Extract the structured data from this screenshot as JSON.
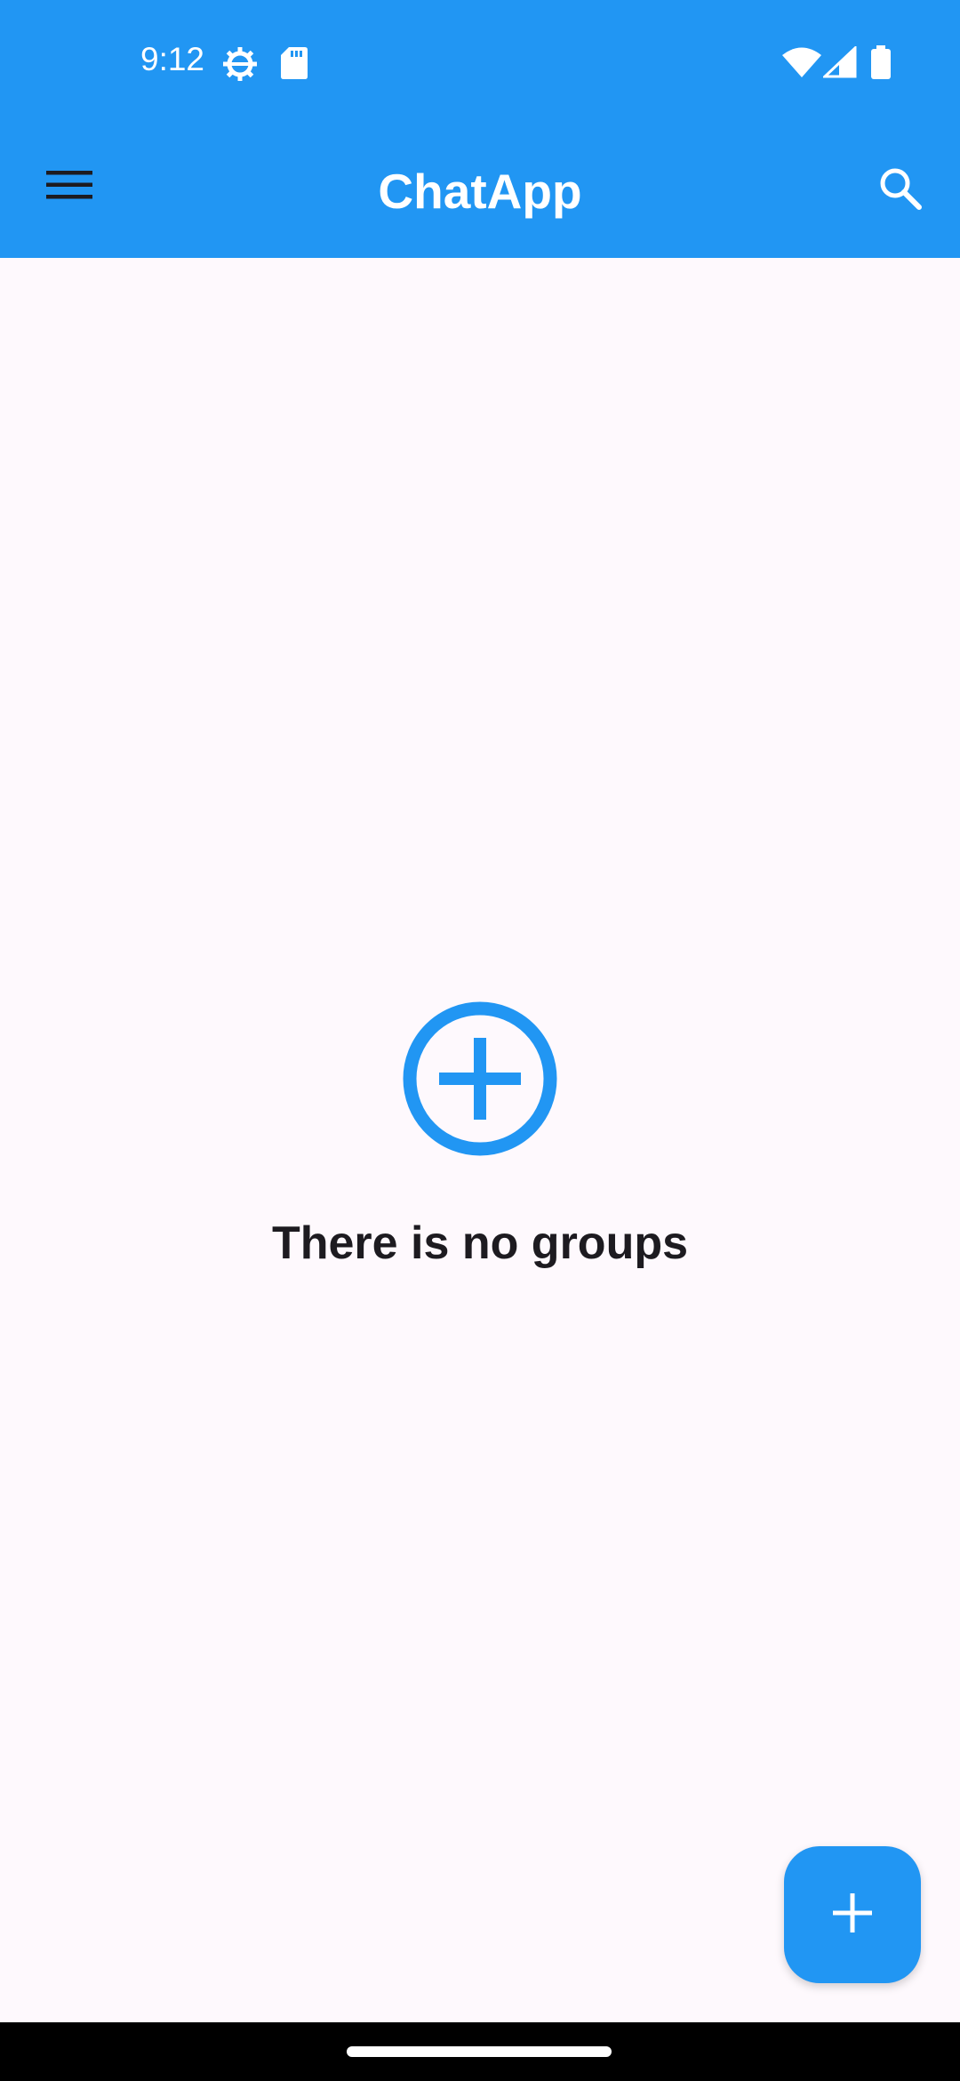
{
  "status_bar": {
    "time": "9:12",
    "icons": [
      "gear-icon",
      "sd-card-icon",
      "wifi-icon",
      "signal-icon",
      "battery-icon"
    ]
  },
  "app_bar": {
    "title": "ChatApp",
    "menu_icon": "menu-icon",
    "search_icon": "search-icon"
  },
  "empty_state": {
    "icon": "add-circle-icon",
    "message": "There is no groups"
  },
  "fab": {
    "icon": "plus-icon"
  },
  "colors": {
    "primary": "#2196F3",
    "background": "#FEF9FD",
    "text_dark": "#1D1B20",
    "on_primary": "#FFFFFF"
  }
}
